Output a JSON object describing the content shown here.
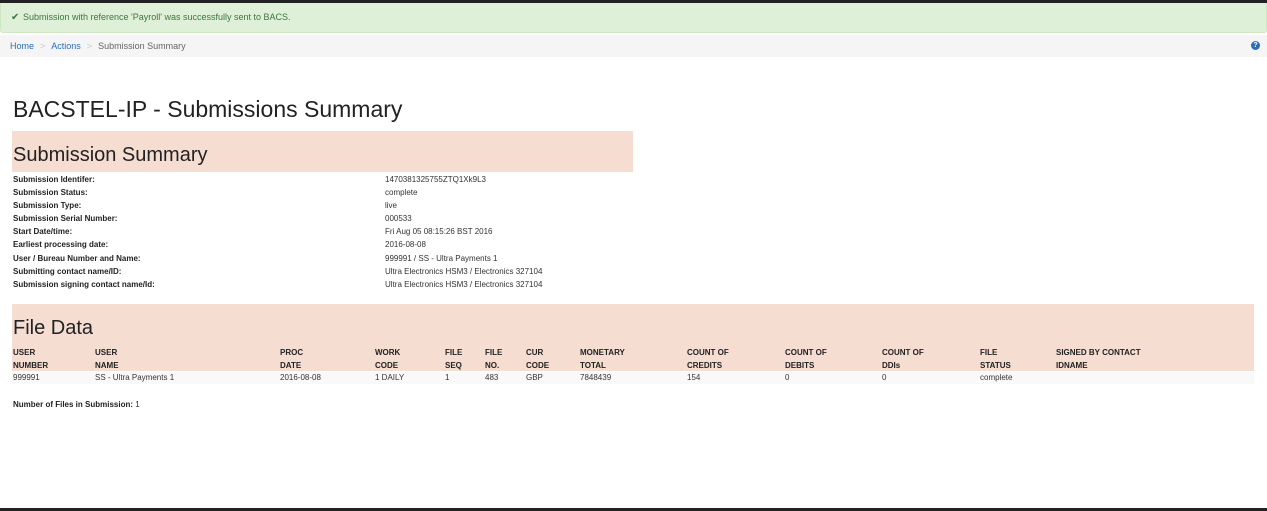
{
  "alert": {
    "icon": "check-icon",
    "message": "Submission with reference 'Payroll' was successfully sent to BACS."
  },
  "breadcrumb": {
    "home": "Home",
    "actions": "Actions",
    "current": "Submission Summary",
    "help_icon": "question-circle-icon"
  },
  "page": {
    "title": "BACSTEL-IP - Submissions Summary"
  },
  "summary": {
    "heading": "Submission Summary",
    "rows": [
      {
        "label": "Submission Identifer:",
        "value": "1470381325755ZTQ1Xk9L3"
      },
      {
        "label": "Submission Status:",
        "value": "complete"
      },
      {
        "label": "Submission Type:",
        "value": "live"
      },
      {
        "label": "Submission Serial Number:",
        "value": "000533"
      },
      {
        "label": "Start Date/time:",
        "value": "Fri Aug 05 08:15:26 BST 2016"
      },
      {
        "label": "Earliest processing date:",
        "value": "2016-08-08"
      },
      {
        "label": "User / Bureau Number and Name:",
        "value": "999991 / SS - Ultra Payments 1"
      },
      {
        "label": "Submitting contact name/ID:",
        "value": "Ultra Electronics HSM3 / Electronics 327104"
      },
      {
        "label": "Submission signing contact name/Id:",
        "value": "Ultra Electronics HSM3 / Electronics 327104"
      }
    ]
  },
  "file_data": {
    "heading": "File Data",
    "columns": [
      [
        "USER",
        "NUMBER"
      ],
      [
        "USER",
        "NAME"
      ],
      [
        "PROC",
        "DATE"
      ],
      [
        "WORK",
        "CODE"
      ],
      [
        "FILE",
        "SEQ"
      ],
      [
        "FILE",
        "NO."
      ],
      [
        "CUR",
        "CODE"
      ],
      [
        "MONETARY",
        "TOTAL"
      ],
      [
        "COUNT OF",
        "CREDITS"
      ],
      [
        "COUNT OF",
        "DEBITS"
      ],
      [
        "COUNT OF",
        "DDIs"
      ],
      [
        "FILE",
        "STATUS"
      ],
      [
        "SIGNED BY CONTACT",
        "IDNAME"
      ]
    ],
    "rows": [
      [
        "999991",
        "SS - Ultra Payments 1",
        "2016-08-08",
        "1 DAILY",
        "1",
        "483",
        "GBP",
        "7848439",
        "154",
        "0",
        "0",
        "complete",
        ""
      ]
    ],
    "files_count_label": "Number of Files in Submission:",
    "files_count_value": "1"
  }
}
